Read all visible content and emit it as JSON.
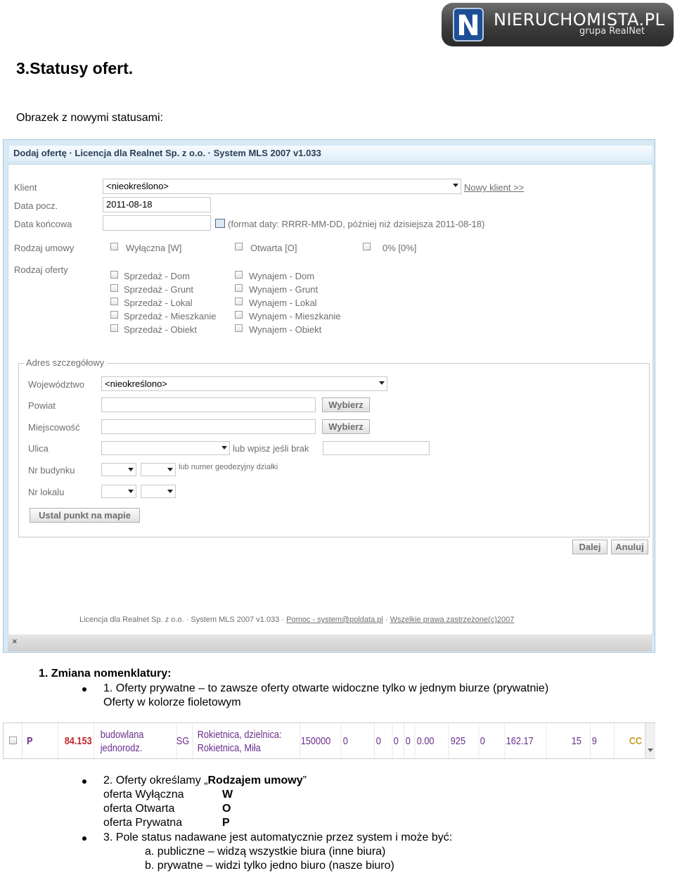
{
  "logo": {
    "letter": "N",
    "name": "NIERUCHOMISTA.PL",
    "sub": "grupa RealNet"
  },
  "heading": "3.Statusy ofert.",
  "intro": "Obrazek z nowymi statusami:",
  "dialog": {
    "title": "Dodaj ofertę · Licencja dla Realnet Sp. z o.o. · System MLS 2007 v1.033",
    "klient_label": "Klient",
    "klient_value": "<nieokreślono>",
    "nowy_klient": "Nowy klient >>",
    "data_pocz_label": "Data pocz.",
    "data_pocz_value": "2011-08-18",
    "data_konc_label": "Data końcowa",
    "data_hint": "(format daty: RRRR-MM-DD, później niż dzisiejsza 2011-08-18)",
    "rodzaj_umowy_label": "Rodzaj umowy",
    "umowy": [
      "Wyłączna [W]",
      "Otwarta [O]",
      "0% [0%]"
    ],
    "rodzaj_oferty_label": "Rodzaj oferty",
    "sprzedaz": [
      "Sprzedaż - Dom",
      "Sprzedaż - Grunt",
      "Sprzedaż - Lokal",
      "Sprzedaż - Mieszkanie",
      "Sprzedaż - Obiekt"
    ],
    "wynajem": [
      "Wynajem - Dom",
      "Wynajem - Grunt",
      "Wynajem - Lokal",
      "Wynajem - Mieszkanie",
      "Wynajem - Obiekt"
    ],
    "adres_legend": "Adres szczegółowy",
    "wojewodztwo_label": "Województwo",
    "wojewodztwo_value": "<nieokreślono>",
    "powiat_label": "Powiat",
    "miejscowosc_label": "Miejscowość",
    "wybierz": "Wybierz",
    "ulica_label": "Ulica",
    "ulica_hint": "lub wpisz jeśli brak",
    "nr_budynku_label": "Nr budynku",
    "nr_budynku_hint": "lub numer geodezyjny działki",
    "nr_lokalu_label": "Nr lokalu",
    "map_button": "Ustal punkt na mapie",
    "dalej": "Dalej",
    "anuluj": "Anuluj",
    "footer_text": "Licencja dla Realnet Sp. z o.o. · System MLS 2007 v1.033 ·",
    "footer_link1": "Pomoc - system@poldata.pl",
    "footer_sep": "·",
    "footer_link2": "Wszelkie prawa zastrzeżone(c)2007",
    "close": "×"
  },
  "list": {
    "item1": "1.   Zmiana nomenklatury:",
    "b1_line1": "1. Oferty prywatne – to zawsze oferty otwarte widoczne tylko w jednym biurze (prywatnie)",
    "b1_line2": "Oferty w kolorze fioletowym",
    "b2_prefix": "2. Oferty określamy „",
    "b2_bold": "Rodzajem umowy",
    "b2_suffix": "”",
    "statuses": [
      {
        "label": "oferta Wyłączna",
        "code": "W"
      },
      {
        "label": "oferta Otwarta",
        "code": "O"
      },
      {
        "label": "oferta Prywatna",
        "code": "P"
      }
    ],
    "b3": "3. Pole status nadawane jest automatycznie przez system i może być:",
    "b3a": "a. publiczne – widzą wszystkie biura (inne biura)",
    "b3b": "b. prywatne – widzi tylko jedno biuro (nasze biuro)"
  },
  "row": {
    "status": "P",
    "number": "84.153",
    "type1": "budowlana",
    "type2": "jednorodz.",
    "region": "SG",
    "loc1": "Rokietnica, dzielnica:",
    "loc2": "Rokietnica, Miła",
    "price": "150000",
    "v1": "0",
    "v2": "0",
    "v3": "0",
    "v4": "0",
    "v5": "0.00",
    "v6": "925",
    "v7": "0",
    "v8": "162.17",
    "v9": "15",
    "v10": "9",
    "tail": "CC",
    "color": "#6a2e8e"
  }
}
